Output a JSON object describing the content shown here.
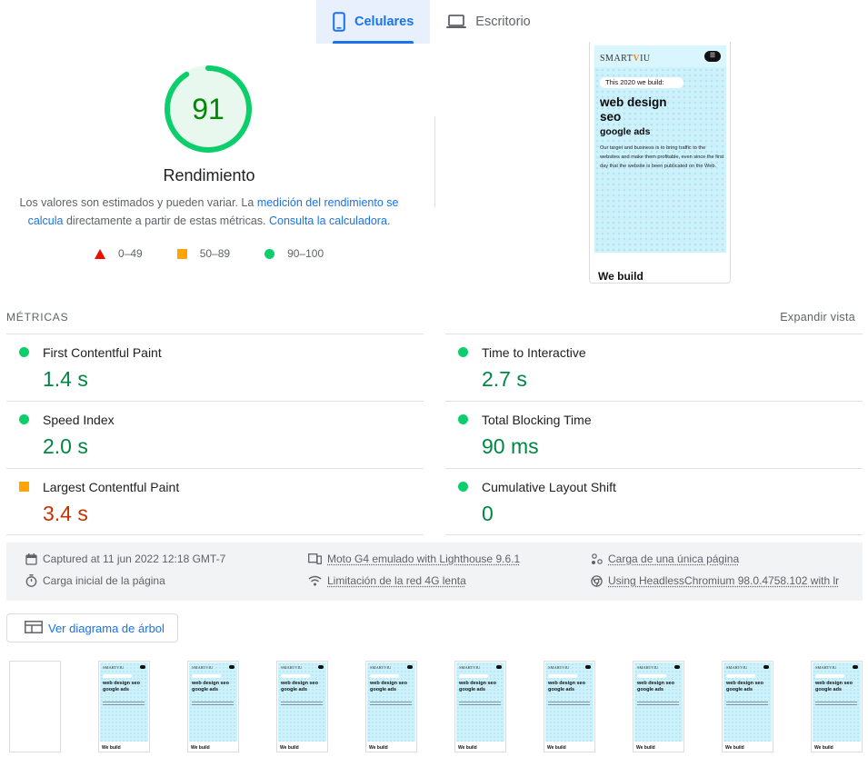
{
  "tabs": [
    {
      "label": "Celulares",
      "active": true,
      "icon": "mobile-icon"
    },
    {
      "label": "Escritorio",
      "active": false,
      "icon": "laptop-icon"
    }
  ],
  "score": {
    "value": "91",
    "fraction": 0.91,
    "color": "#0cce6b",
    "title": "Rendimiento",
    "desc_1": "Los valores son estimados y pueden variar. La ",
    "desc_link_1": "medición del rendimiento se calcula",
    "desc_2": " directamente a partir de estas métricas. ",
    "desc_link_2": "Consulta la calculadora",
    "desc_3": "."
  },
  "legend": [
    {
      "label": "0–49",
      "shape": "triangle",
      "color": "#eb0f00"
    },
    {
      "label": "50–89",
      "shape": "square",
      "color": "#ffa400"
    },
    {
      "label": "90–100",
      "shape": "circle",
      "color": "#0cce6b"
    }
  ],
  "preview": {
    "logo_a": "SMART",
    "logo_v": "V",
    "logo_b": "IU",
    "menu": "☰",
    "pill": "This 2020 we build:",
    "h1_a": "web design",
    "h1_b": "seo",
    "h2": "google ads",
    "paragraph": "Our target and business is to bring traffic to the websites and make them profitable, even since the first day that the website is been publicated on the Web.",
    "bottom": "We build"
  },
  "metrics": {
    "label": "MÉTRICAS",
    "expand": "Expandir vista",
    "left": [
      {
        "name": "First Contentful Paint",
        "value": "1.4 s",
        "status": "good"
      },
      {
        "name": "Speed Index",
        "value": "2.0 s",
        "status": "good"
      },
      {
        "name": "Largest Contentful Paint",
        "value": "3.4 s",
        "status": "average"
      }
    ],
    "right": [
      {
        "name": "Time to Interactive",
        "value": "2.7 s",
        "status": "good"
      },
      {
        "name": "Total Blocking Time",
        "value": "90 ms",
        "status": "good"
      },
      {
        "name": "Cumulative Layout Shift",
        "value": "0",
        "status": "good"
      }
    ]
  },
  "runtime": {
    "captured": "Captured at 11 jun 2022 12:18 GMT-7",
    "device": "Moto G4 emulado with Lighthouse 9.6.1",
    "single_page": "Carga de una única página",
    "initial_load": "Carga inicial de la página",
    "network": "Limitación de la red 4G lenta",
    "browser": "Using HeadlessChromium 98.0.4758.102 with lr"
  },
  "treemap_button": "Ver diagrama de árbol",
  "filmstrip": {
    "frame_count": 10,
    "logo": "SMARTVIU",
    "title": "web design seo google ads",
    "bottom": "We build"
  }
}
